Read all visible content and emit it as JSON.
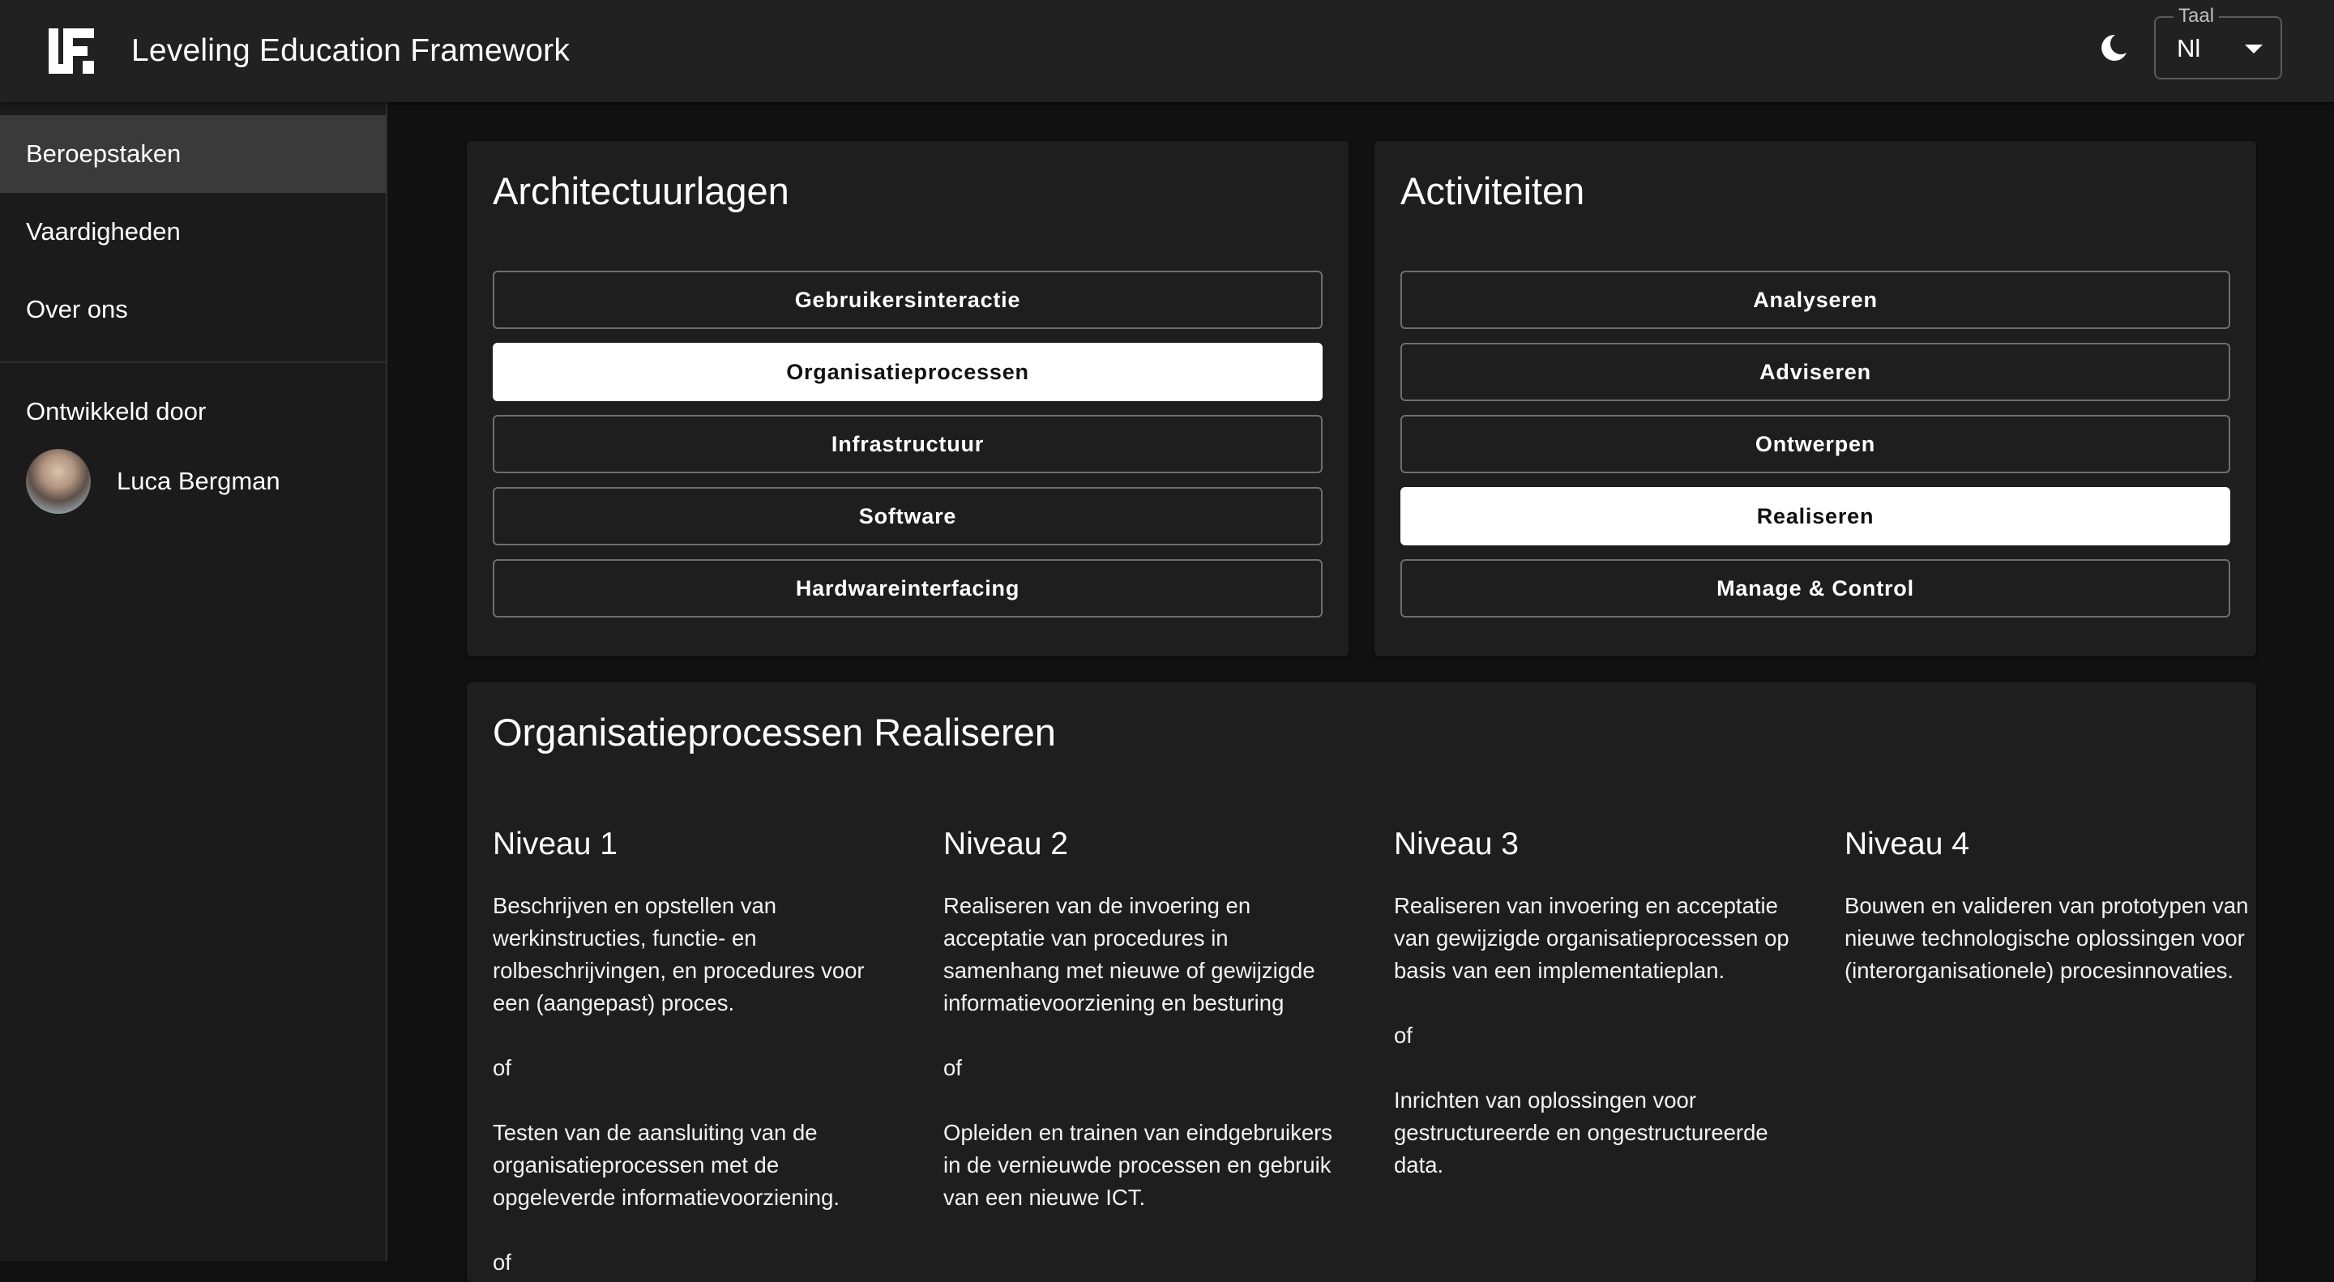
{
  "header": {
    "title": "Leveling Education Framework",
    "language_label": "Taal",
    "language_value": "Nl"
  },
  "sidebar": {
    "items": [
      {
        "label": "Beroepstaken"
      },
      {
        "label": "Vaardigheden"
      },
      {
        "label": "Over ons"
      }
    ],
    "developed_by": "Ontwikkeld door",
    "developer_name": "Luca Bergman"
  },
  "architecture": {
    "title": "Architectuurlagen",
    "options": [
      "Gebruikersinteractie",
      "Organisatieprocessen",
      "Infrastructuur",
      "Software",
      "Hardwareinterfacing"
    ],
    "selected": "Organisatieprocessen"
  },
  "activities": {
    "title": "Activiteiten",
    "options": [
      "Analyseren",
      "Adviseren",
      "Ontwerpen",
      "Realiseren",
      "Manage & Control"
    ],
    "selected": "Realiseren"
  },
  "detail": {
    "title": "Organisatieprocessen Realiseren",
    "levels": [
      {
        "title": "Niveau 1",
        "text": "Beschrijven en opstellen van werkinstructies, functie- en rolbeschrijvingen, en procedures voor een (aangepast) proces.\n\nof\n\nTesten van de aansluiting van de organisatieprocessen met de opgeleverde informatievoorziening.\n\nof"
      },
      {
        "title": "Niveau 2",
        "text": "Realiseren van de invoering en acceptatie van procedures in samenhang met nieuwe of gewijzigde informatievoorziening en besturing\n\nof\n\nOpleiden en trainen van eindgebruikers in de vernieuwde processen en gebruik van een nieuwe ICT."
      },
      {
        "title": "Niveau 3",
        "text": "Realiseren van invoering en acceptatie van gewijzigde organisatieprocessen op basis van een implementatieplan.\n\nof\n\nInrichten van oplossingen voor gestructureerde en ongestructureerde data."
      },
      {
        "title": "Niveau 4",
        "text": "Bouwen en valideren van prototypen van nieuwe technologische oplossingen voor (interorganisationele) procesinnovaties."
      }
    ]
  }
}
